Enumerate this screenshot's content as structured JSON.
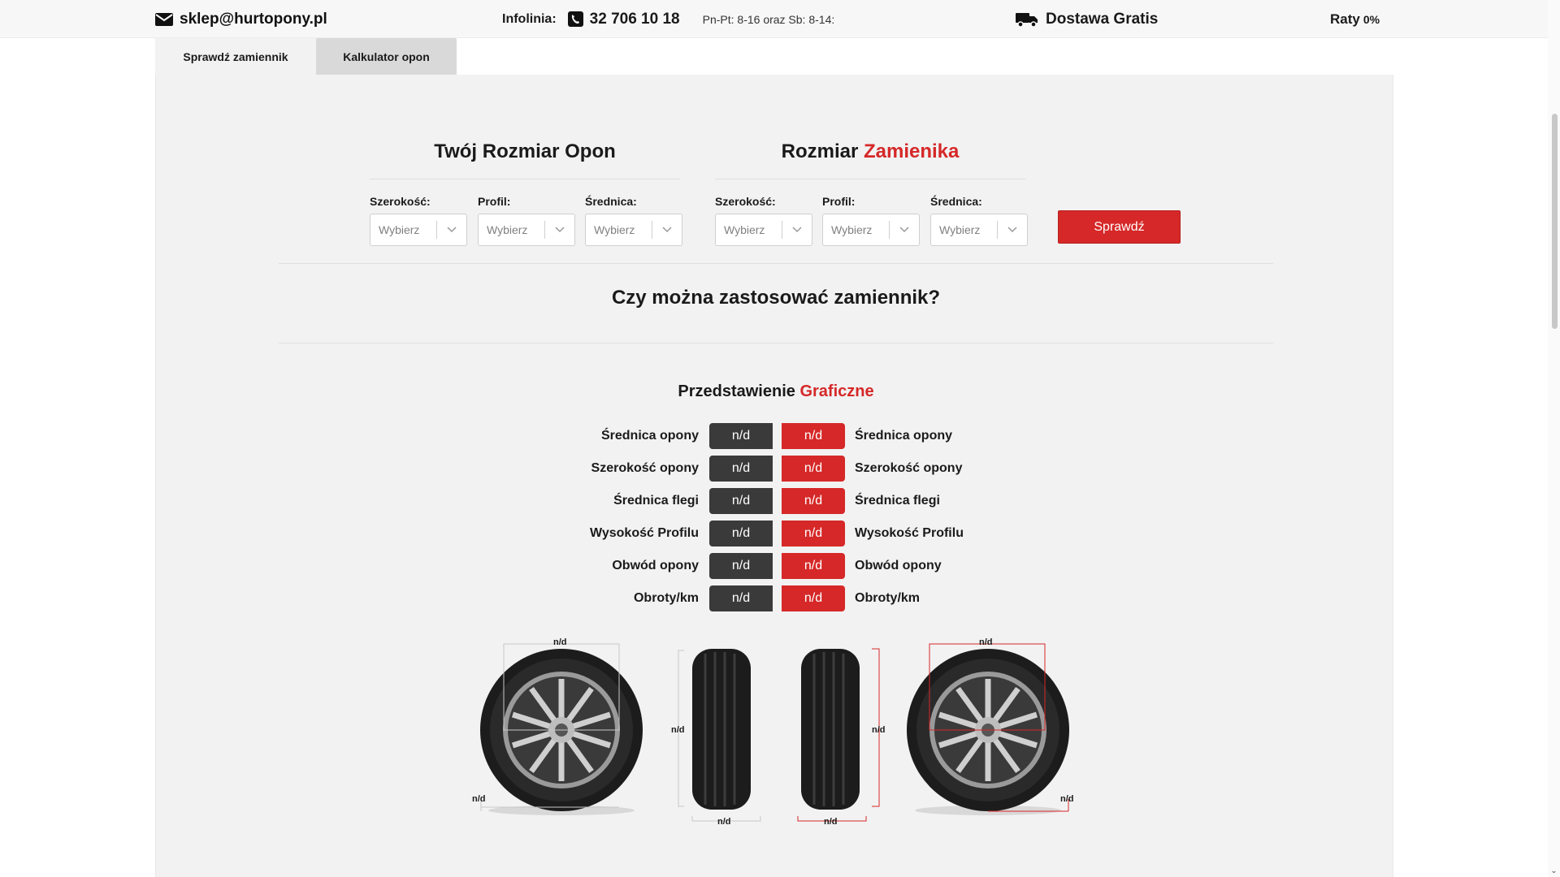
{
  "topbar": {
    "email": "sklep@hurtopony.pl",
    "infolinia_label": "Infolinia:",
    "phone": "32 706 10 18",
    "hours": "Pn-Pt: 8-16 oraz Sb: 8-14:",
    "delivery": "Dostawa Gratis",
    "raty_label": "Raty",
    "raty_value": "0%"
  },
  "tabs": [
    {
      "label": "Sprawdź zamiennik",
      "active": true
    },
    {
      "label": "Kalkulator opon",
      "active": false
    }
  ],
  "left_group": {
    "title": "Twój Rozmiar Opon",
    "fields": [
      {
        "label": "Szerokość:",
        "value": "Wybierz"
      },
      {
        "label": "Profil:",
        "value": "Wybierz"
      },
      {
        "label": "Średnica:",
        "value": "Wybierz"
      }
    ]
  },
  "right_group": {
    "title_plain": "Rozmiar",
    "title_accent": "Zamienika",
    "fields": [
      {
        "label": "Szerokość:",
        "value": "Wybierz"
      },
      {
        "label": "Profil:",
        "value": "Wybierz"
      },
      {
        "label": "Średnica:",
        "value": "Wybierz"
      }
    ]
  },
  "check_button": "Sprawdź",
  "question": "Czy można zastosować zamiennik?",
  "graphic": {
    "title_plain": "Przedstawienie",
    "title_accent": "Graficzne",
    "rows": [
      {
        "label": "Średnica opony",
        "left": "n/d",
        "right": "n/d"
      },
      {
        "label": "Szerokość opony",
        "left": "n/d",
        "right": "n/d"
      },
      {
        "label": "Średnica flegi",
        "left": "n/d",
        "right": "n/d"
      },
      {
        "label": "Wysokość Profilu",
        "left": "n/d",
        "right": "n/d"
      },
      {
        "label": "Obwód opony",
        "left": "n/d",
        "right": "n/d"
      },
      {
        "label": "Obroty/km",
        "left": "n/d",
        "right": "n/d"
      }
    ],
    "dim_label": "n/d"
  },
  "colors": {
    "accent": "#d62828",
    "dark_pill": "#3a3a3a",
    "panel_bg": "#f2f2f2"
  },
  "icons": {
    "email": "envelope-icon",
    "phone": "phone-icon",
    "delivery": "truck-icon",
    "select": "chevron-down-icon"
  }
}
